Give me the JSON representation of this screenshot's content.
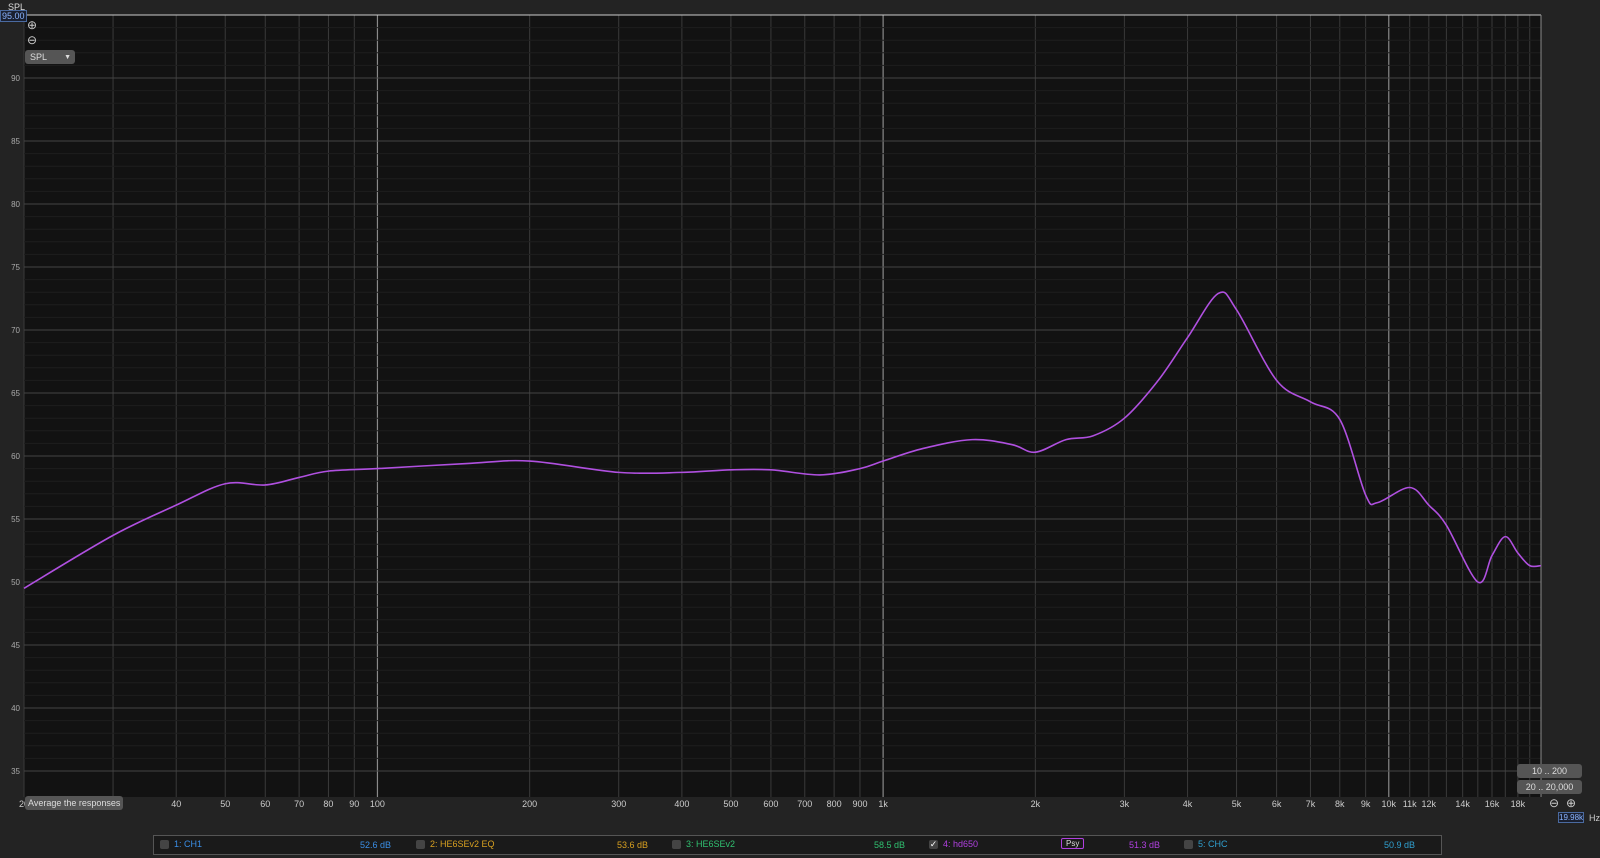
{
  "header": {
    "y_axis_label": "SPL",
    "y_max_value": "95.00",
    "unit_selector": "SPL",
    "x_unit": "Hz",
    "x_cursor_value": "19.98k"
  },
  "buttons": {
    "average": "Average the responses",
    "range1": "10 .. 200",
    "range2": "20 .. 20,000"
  },
  "legend": [
    {
      "label": "1: CH1",
      "value": "52.6 dB",
      "color": "#3a8ee6",
      "checked": false
    },
    {
      "label": "2: HE6SEv2 EQ",
      "value": "53.6 dB",
      "color": "#d8a020",
      "checked": false
    },
    {
      "label": "3: HE6SEv2",
      "value": "58.5 dB",
      "color": "#30c070",
      "checked": false
    },
    {
      "label": "4: hd650",
      "value": "51.3 dB",
      "color": "#b040e0",
      "checked": true,
      "badge": "Psy"
    },
    {
      "label": "5: CHC",
      "value": "50.9 dB",
      "color": "#30a0d0",
      "checked": false
    }
  ],
  "chart_data": {
    "type": "line",
    "xscale": "log",
    "xlim": [
      20,
      20000
    ],
    "ylim": [
      33,
      95
    ],
    "ylabel": "SPL",
    "xlabel": "Hz",
    "grid": true,
    "yticks": [
      "90",
      "85",
      "80",
      "75",
      "70",
      "65",
      "60",
      "55",
      "50",
      "45",
      "40",
      "35"
    ],
    "xticks": [
      [
        "20",
        20
      ],
      [
        "30",
        30
      ],
      [
        "40",
        40
      ],
      [
        "50",
        50
      ],
      [
        "60",
        60
      ],
      [
        "70",
        70
      ],
      [
        "80",
        80
      ],
      [
        "90",
        90
      ],
      [
        "100",
        100
      ],
      [
        "200",
        200
      ],
      [
        "300",
        300
      ],
      [
        "400",
        400
      ],
      [
        "500",
        500
      ],
      [
        "600",
        600
      ],
      [
        "700",
        700
      ],
      [
        "800",
        800
      ],
      [
        "900",
        900
      ],
      [
        "1k",
        1000
      ],
      [
        "2k",
        2000
      ],
      [
        "3k",
        3000
      ],
      [
        "4k",
        4000
      ],
      [
        "5k",
        5000
      ],
      [
        "6k",
        6000
      ],
      [
        "7k",
        7000
      ],
      [
        "8k",
        8000
      ],
      [
        "9k",
        9000
      ],
      [
        "10k",
        10000
      ],
      [
        "11k",
        11000
      ],
      [
        "12k",
        12000
      ],
      [
        "14k",
        14000
      ],
      [
        "16k",
        16000
      ],
      [
        "18k",
        18000
      ]
    ],
    "series": [
      {
        "name": "4: hd650",
        "color": "#b050e0",
        "x": [
          20,
          30,
          40,
          50,
          60,
          70,
          80,
          100,
          150,
          200,
          300,
          400,
          500,
          600,
          750,
          900,
          1000,
          1200,
          1500,
          1800,
          2000,
          2300,
          2600,
          3000,
          3500,
          4000,
          4600,
          5000,
          6000,
          7000,
          8000,
          9000,
          9500,
          11000,
          12000,
          13000,
          15000,
          16000,
          17000,
          18000,
          19000,
          20000
        ],
        "y": [
          49.5,
          53.7,
          56.1,
          57.8,
          57.7,
          58.3,
          58.8,
          59.0,
          59.4,
          59.6,
          58.7,
          58.7,
          58.9,
          58.9,
          58.5,
          59.0,
          59.6,
          60.6,
          61.3,
          60.9,
          60.3,
          61.3,
          61.6,
          63.0,
          66.0,
          69.4,
          72.9,
          71.6,
          66.0,
          64.3,
          62.9,
          56.9,
          56.3,
          57.5,
          56.1,
          54.5,
          50.0,
          52.1,
          53.6,
          52.3,
          51.3,
          51.3
        ]
      }
    ]
  }
}
